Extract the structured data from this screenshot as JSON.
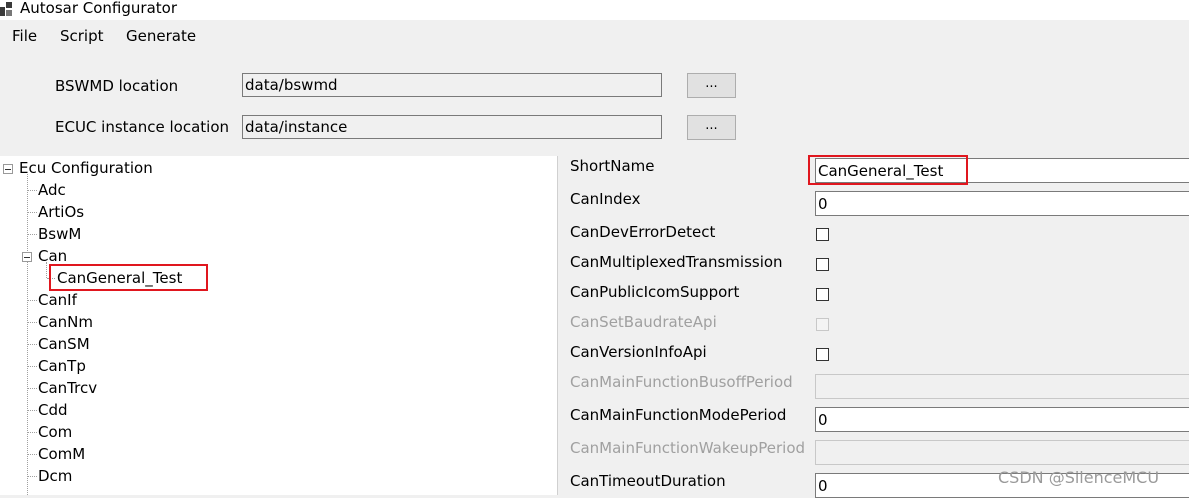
{
  "window": {
    "title": "Autosar Configurator",
    "icon": "app-icon"
  },
  "menu": [
    "File",
    "Script",
    "Generate"
  ],
  "locations": {
    "bswmd": {
      "label": "BSWMD location",
      "value": "data/bswmd",
      "button": "..."
    },
    "ecuc": {
      "label": "ECUC instance location",
      "value": "data/instance",
      "button": "..."
    }
  },
  "tree": {
    "root": "Ecu Configuration",
    "items": [
      "Adc",
      "ArtiOs",
      "BswM",
      "Can",
      "CanGeneral_Test",
      "CanIf",
      "CanNm",
      "CanSM",
      "CanTp",
      "CanTrcv",
      "Cdd",
      "Com",
      "ComM",
      "Dcm"
    ],
    "selected": "CanGeneral_Test",
    "highlight_color": "#e0161e"
  },
  "properties": {
    "short_name": {
      "label": "ShortName",
      "value": "CanGeneral_Test"
    },
    "can_index": {
      "label": "CanIndex",
      "value": "0"
    },
    "dev_error_detect": {
      "label": "CanDevErrorDetect"
    },
    "multiplexed_transmission": {
      "label": "CanMultiplexedTransmission"
    },
    "public_icom_support": {
      "label": "CanPublicIcomSupport"
    },
    "set_baudrate_api": {
      "label": "CanSetBaudrateApi"
    },
    "version_info_api": {
      "label": "CanVersionInfoApi"
    },
    "busoff_period": {
      "label": "CanMainFunctionBusoffPeriod",
      "value": ""
    },
    "mode_period": {
      "label": "CanMainFunctionModePeriod",
      "value": "0"
    },
    "wakeup_period": {
      "label": "CanMainFunctionWakeupPeriod",
      "value": ""
    },
    "timeout_duration": {
      "label": "CanTimeoutDuration",
      "value": "0"
    }
  },
  "watermark": "CSDN @SilenceMCU"
}
